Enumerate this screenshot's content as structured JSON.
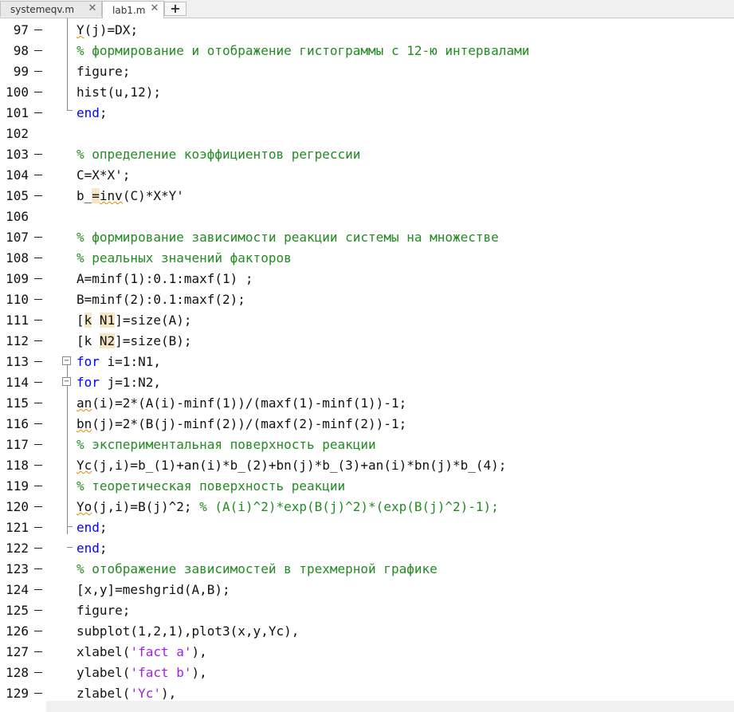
{
  "tabs": [
    {
      "label": "systemeqv.m",
      "active": false
    },
    {
      "label": "lab1.m",
      "active": true
    }
  ],
  "tab_close_glyph": "✕",
  "tab_add_glyph": "+",
  "fold_glyph": "−",
  "lines": [
    {
      "num": "97",
      "code": "Y(j)=DX;"
    },
    {
      "num": "98",
      "code": "% формирование и отображение гистограммы с 12-ю интервалами"
    },
    {
      "num": "99",
      "code": "figure;"
    },
    {
      "num": "100",
      "code": "hist(u,12);"
    },
    {
      "num": "101",
      "code": "end;"
    },
    {
      "num": "102",
      "code": ""
    },
    {
      "num": "103",
      "code": "% определение коэффициентов регрессии"
    },
    {
      "num": "104",
      "code": "C=X*X';"
    },
    {
      "num": "105",
      "code": "b_=inv(C)*X*Y'"
    },
    {
      "num": "106",
      "code": ""
    },
    {
      "num": "107",
      "code": "% формирование зависимости реакции системы на множестве"
    },
    {
      "num": "108",
      "code": "% реальных значений факторов"
    },
    {
      "num": "109",
      "code": "A=minf(1):0.1:maxf(1) ;"
    },
    {
      "num": "110",
      "code": "B=minf(2):0.1:maxf(2);"
    },
    {
      "num": "111",
      "code": "[k N1]=size(A);"
    },
    {
      "num": "112",
      "code": "[k N2]=size(B);"
    },
    {
      "num": "113",
      "code": "for i=1:N1,"
    },
    {
      "num": "114",
      "code": "for j=1:N2,"
    },
    {
      "num": "115",
      "code": "an(i)=2*(A(i)-minf(1))/(maxf(1)-minf(1))-1;"
    },
    {
      "num": "116",
      "code": "bn(j)=2*(B(j)-minf(2))/(maxf(2)-minf(2))-1;"
    },
    {
      "num": "117",
      "code": "% экспериментальная поверхность реакции"
    },
    {
      "num": "118",
      "code": "Yc(j,i)=b_(1)+an(i)*b_(2)+bn(j)*b_(3)+an(i)*bn(j)*b_(4);"
    },
    {
      "num": "119",
      "code": "% теоретическая поверхность реакции"
    },
    {
      "num": "120",
      "code": "Yo(j,i)=B(j)^2; % (A(i)^2)*exp(B(j)^2)*(exp(B(j)^2)-1);"
    },
    {
      "num": "121",
      "code": "end;"
    },
    {
      "num": "122",
      "code": "end;"
    },
    {
      "num": "123",
      "code": "% отображение зависимостей в трехмерной графике"
    },
    {
      "num": "124",
      "code": "[x,y]=meshgrid(A,B);"
    },
    {
      "num": "125",
      "code": "figure;"
    },
    {
      "num": "126",
      "code": "subplot(1,2,1),plot3(x,y,Yc),"
    },
    {
      "num": "127",
      "code": "xlabel('fact a'),"
    },
    {
      "num": "128",
      "code": "ylabel('fact b'),"
    },
    {
      "num": "129",
      "code": "zlabel('Yc'),"
    }
  ],
  "colors": {
    "keyword": "#0000ff",
    "comment": "#228b22",
    "string": "#a020f0",
    "highlight": "#f5e6c4",
    "warning_squiggle": "#e08a00"
  }
}
